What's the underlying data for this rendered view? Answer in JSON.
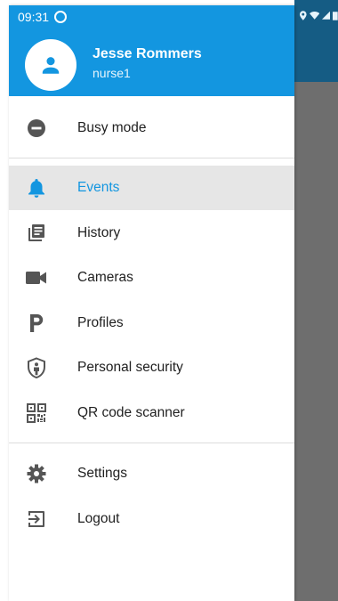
{
  "status_bar": {
    "time": "09:31"
  },
  "user": {
    "name": "Jesse Rommers",
    "username": "nurse1"
  },
  "busy": {
    "label": "Busy mode"
  },
  "menu": [
    {
      "label": "Events",
      "icon": "bell-icon"
    },
    {
      "label": "History",
      "icon": "history-icon"
    },
    {
      "label": "Cameras",
      "icon": "video-camera-icon"
    },
    {
      "label": "Profiles",
      "icon": "profiles-p-icon"
    },
    {
      "label": "Personal security",
      "icon": "shield-person-icon"
    },
    {
      "label": "QR code scanner",
      "icon": "qr-code-icon"
    }
  ],
  "footer_menu": [
    {
      "label": "Settings",
      "icon": "gear-icon"
    },
    {
      "label": "Logout",
      "icon": "logout-icon"
    }
  ],
  "colors": {
    "accent": "#1396e0",
    "active_bg": "#e6e6e6",
    "icon": "#555555"
  }
}
